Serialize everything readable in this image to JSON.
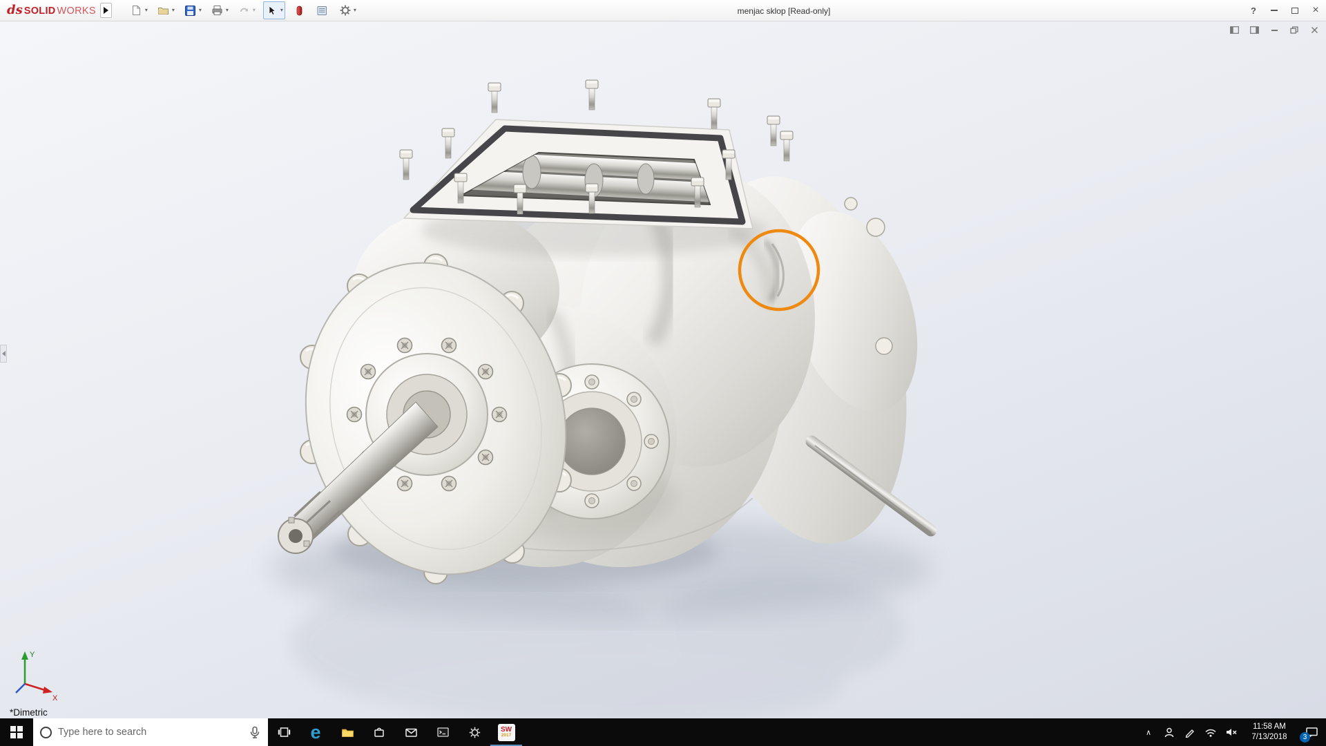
{
  "colors": {
    "brand_red": "#c02027",
    "annotation_orange": "#ee8912",
    "taskbar_background": "#0b0b0b",
    "viewport_gradient_top": "#f5f6f9",
    "viewport_gradient_bottom": "#d8dce5"
  },
  "titlebar": {
    "brand": {
      "monogram": "ds",
      "solid": "SOLID",
      "works": "WORKS"
    },
    "document_title": "menjac sklop [Read-only]",
    "help_label": "?",
    "close_label": "×",
    "caret": "▾",
    "toolbar_icons": [
      "new-document",
      "open",
      "save",
      "print",
      "undo",
      "select",
      "toolbox",
      "file-properties",
      "options"
    ]
  },
  "viewport": {
    "view_label": "*Dimetric",
    "triad": {
      "x": "X",
      "y": "Y"
    },
    "annotation": {
      "shape": "circle",
      "color": "#ee8912"
    }
  },
  "taskbar": {
    "search_placeholder": "Type here to search",
    "tray_chevron": "∧",
    "icon_glyphs": {
      "edge": "e"
    },
    "solidworks_icon": {
      "text": "SW",
      "year": "2017"
    },
    "clock": {
      "time": "11:58 AM",
      "date": "7/13/2018"
    },
    "notification_count": "3",
    "app_icons": [
      "start",
      "cortana-search",
      "microphone",
      "task-view",
      "edge",
      "file-explorer",
      "store",
      "mail",
      "command-prompt",
      "settings",
      "solidworks"
    ],
    "tray_icons": [
      "hidden-icons",
      "people",
      "pen",
      "wifi",
      "volume",
      "clock",
      "action-center"
    ]
  }
}
